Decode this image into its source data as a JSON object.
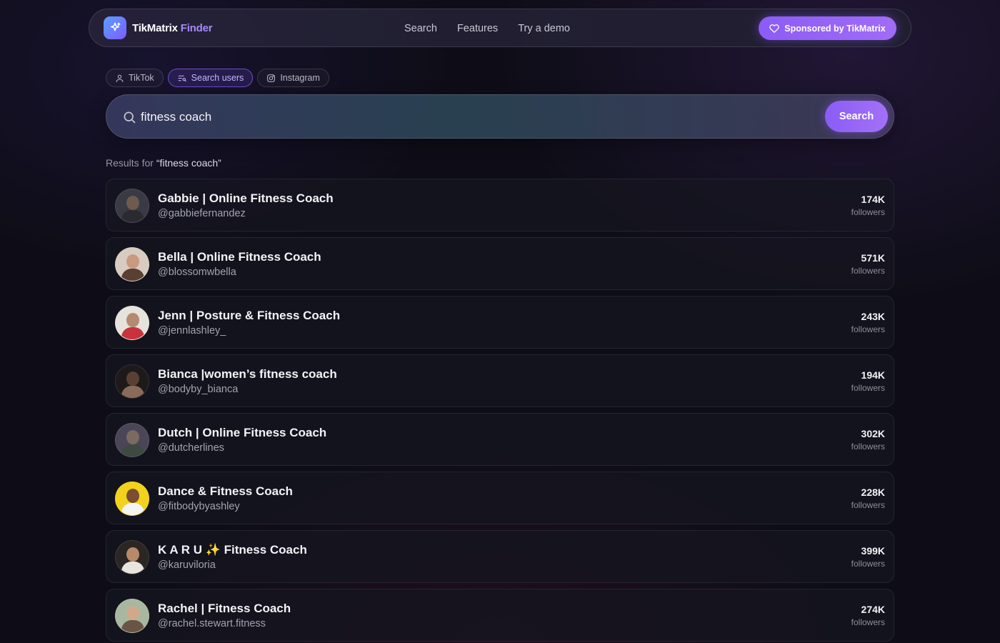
{
  "brand": {
    "name": "TikMatrix",
    "accent": "Finder",
    "logo_icon": "sparkle-icon"
  },
  "nav": {
    "links": [
      "Search",
      "Features",
      "Try a demo"
    ]
  },
  "sponsor": {
    "label": "Sponsored by TikMatrix",
    "icon": "heart-icon"
  },
  "tabs": [
    {
      "label": "TikTok",
      "icon": "user-icon",
      "active": false
    },
    {
      "label": "Search users",
      "icon": "list-search-icon",
      "active": true
    },
    {
      "label": "Instagram",
      "icon": "instagram-icon",
      "active": false
    }
  ],
  "search": {
    "value": "fitness coach",
    "button_label": "Search"
  },
  "results": {
    "prefix": "Results for ",
    "query": "“fitness coach”",
    "followers_label": "followers",
    "items": [
      {
        "name": "Gabbie | Online Fitness Coach",
        "handle": "@gabbiefernandez",
        "followers": "174K"
      },
      {
        "name": "Bella | Online Fitness Coach",
        "handle": "@blossomwbella",
        "followers": "571K"
      },
      {
        "name": "Jenn  |  Posture & Fitness Coach",
        "handle": "@jennlashley_",
        "followers": "243K"
      },
      {
        "name": "Bianca |women’s fitness coach",
        "handle": "@bodyby_bianca",
        "followers": "194K"
      },
      {
        "name": "Dutch | Online Fitness Coach",
        "handle": "@dutcherlines",
        "followers": "302K"
      },
      {
        "name": "Dance & Fitness Coach",
        "handle": "@fitbodybyashley",
        "followers": "228K"
      },
      {
        "name": "K A R U ✨ Fitness Coach",
        "handle": "@karuviloria",
        "followers": "399K"
      },
      {
        "name": "Rachel | Fitness Coach",
        "handle": "@rachel.stewart.fitness",
        "followers": "274K"
      }
    ]
  },
  "colors": {
    "accent": "#8b5cf6",
    "background": "#0e0d17",
    "card": "#161520"
  }
}
